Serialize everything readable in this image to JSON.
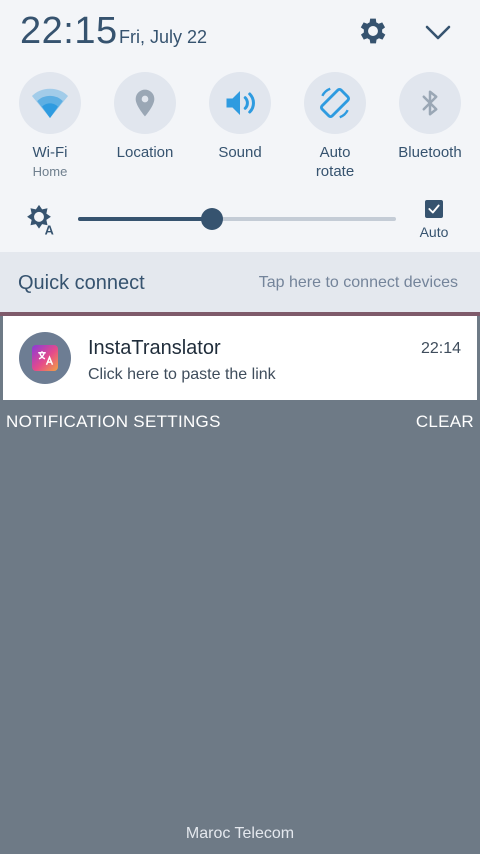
{
  "header": {
    "time": "22:15",
    "date": "Fri, July 22"
  },
  "quick_settings": [
    {
      "label": "Wi-Fi",
      "sublabel": "Home",
      "icon": "wifi-icon",
      "active": true
    },
    {
      "label": "Location",
      "sublabel": "",
      "icon": "location-icon",
      "active": false
    },
    {
      "label": "Sound",
      "sublabel": "",
      "icon": "sound-icon",
      "active": true
    },
    {
      "label": "Auto\nrotate",
      "sublabel": "",
      "icon": "auto-rotate-icon",
      "active": true
    },
    {
      "label": "Bluetooth",
      "sublabel": "",
      "icon": "bluetooth-icon",
      "active": false
    }
  ],
  "brightness": {
    "level": 0.42,
    "auto_label": "Auto",
    "auto_checked": true
  },
  "quick_connect": {
    "title": "Quick connect",
    "hint": "Tap here to connect devices"
  },
  "notification": {
    "app_name": "InstaTranslator",
    "text": "Click here to paste the link",
    "time": "22:14",
    "icon": "translate-icon"
  },
  "actions": {
    "settings_label": "NOTIFICATION SETTINGS",
    "clear_label": "CLEAR"
  },
  "footer": {
    "carrier": "Maroc Telecom"
  },
  "colors": {
    "accent": "#36536f",
    "panel_bg": "#f3f5f8",
    "shade_bg": "#6e7a86"
  }
}
